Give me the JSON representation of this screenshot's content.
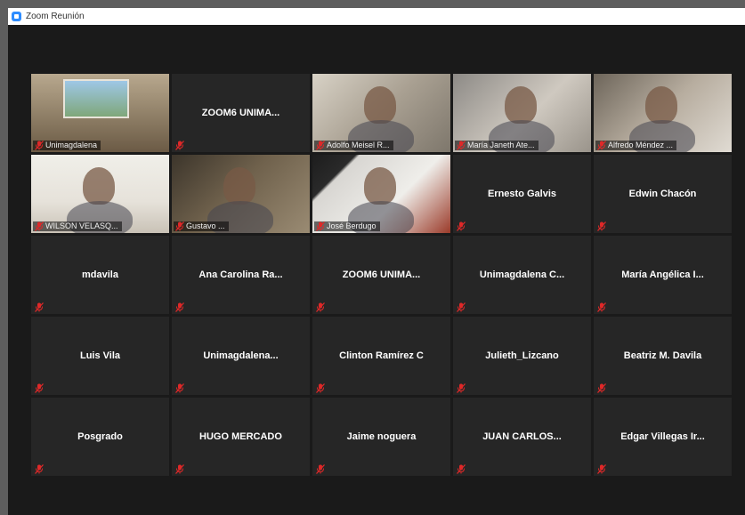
{
  "window": {
    "title": "Zoom Reunión",
    "icon": "zoom-camera-icon"
  },
  "tiles": [
    {
      "name": "Unimagdalena",
      "video": true,
      "video_class": "v1",
      "active": false
    },
    {
      "name": "ZOOM6  UNIMA...",
      "video": false
    },
    {
      "name": "Adolfo Meisel R...",
      "video": true,
      "video_class": "v3",
      "active": false
    },
    {
      "name": "María Janeth Ate...",
      "video": true,
      "video_class": "v4",
      "active": false
    },
    {
      "name": "Alfredo Méndez ...",
      "video": true,
      "video_class": "v5",
      "active": false
    },
    {
      "name": "WILSON VELASQ...",
      "video": true,
      "video_class": "v6",
      "active": false
    },
    {
      "name": "Gustavo ...",
      "video": true,
      "video_class": "v7",
      "active": true
    },
    {
      "name": "José Berdugo",
      "video": true,
      "video_class": "v8",
      "active": false
    },
    {
      "name": "Ernesto Galvis",
      "video": false
    },
    {
      "name": "Edwin Chacón",
      "video": false
    },
    {
      "name": "mdavila",
      "video": false
    },
    {
      "name": "Ana Carolina Ra...",
      "video": false
    },
    {
      "name": "ZOOM6  UNIMA...",
      "video": false
    },
    {
      "name": "Unimagdalena  C...",
      "video": false
    },
    {
      "name": "María Angélica I...",
      "video": false
    },
    {
      "name": "Luis Vila",
      "video": false
    },
    {
      "name": "Unimagdalena...",
      "video": false
    },
    {
      "name": "Clinton Ramírez C",
      "video": false
    },
    {
      "name": "Julieth_Lizcano",
      "video": false
    },
    {
      "name": "Beatriz M. Davila",
      "video": false
    },
    {
      "name": "Posgrado",
      "video": false
    },
    {
      "name": "HUGO MERCADO",
      "video": false
    },
    {
      "name": "Jaime noguera",
      "video": false
    },
    {
      "name": "JUAN CARLOS...",
      "video": false
    },
    {
      "name": "Edgar  Villegas Ir...",
      "video": false
    }
  ],
  "colors": {
    "mute_icon": "#e02828",
    "active_speaker": "#c6e33b",
    "tile_bg": "#262626",
    "window_bg": "#1a1a1a"
  }
}
